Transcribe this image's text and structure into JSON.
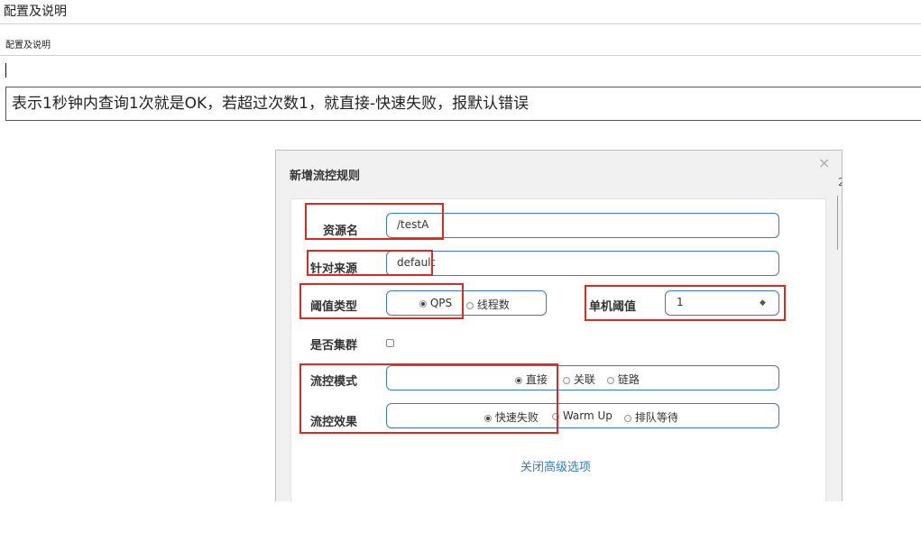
{
  "header": {
    "title": "配置及说明",
    "subtitle": "配置及说明",
    "cursor_text": "|"
  },
  "description": "表示1秒钟内查询1次就是OK，若超过次数1，就直接-快速失败，报默认错误",
  "dialog": {
    "title": "新增流控规则",
    "close_glyph": "×",
    "edge_glyph": "2",
    "fields": {
      "resource_name": {
        "label": "资源名",
        "value": "/testA"
      },
      "source": {
        "label": "针对来源",
        "value": "default"
      },
      "threshold_type": {
        "label": "阈值类型",
        "options": [
          "QPS",
          "线程数"
        ],
        "selected": "QPS"
      },
      "single_threshold": {
        "label": "单机阈值",
        "value": "1",
        "spinner_glyph": "◆"
      },
      "cluster": {
        "label": "是否集群",
        "checked": false
      },
      "flow_mode": {
        "label": "流控模式",
        "options": [
          "直接",
          "关联",
          "链路"
        ],
        "selected": "直接"
      },
      "flow_effect": {
        "label": "流控效果",
        "options": [
          "快速失败",
          "Warm Up",
          "排队等待"
        ],
        "selected": "快速失败"
      }
    },
    "advanced_link": "关闭高级选项"
  },
  "colors": {
    "annotation_red": "#e0281c",
    "field_border": "#3a7bbf",
    "link": "#2f7cc9"
  }
}
